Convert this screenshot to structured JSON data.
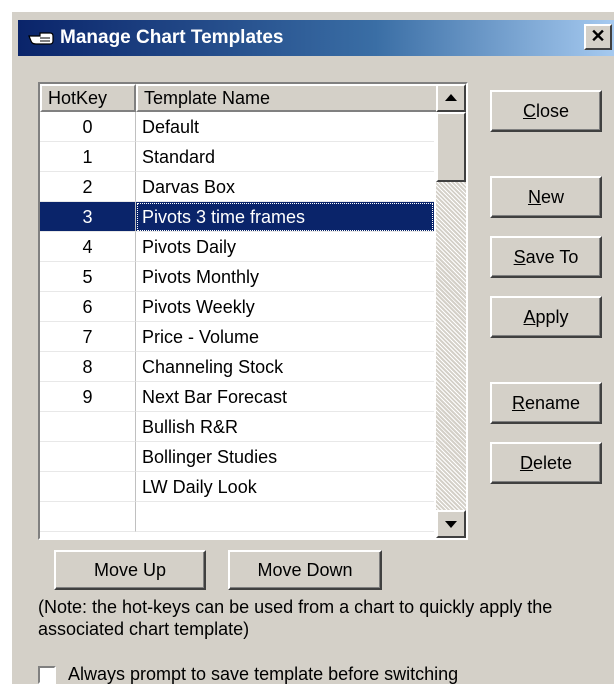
{
  "window": {
    "title": "Manage Chart Templates",
    "close_glyph": "✕"
  },
  "list": {
    "columns": [
      "HotKey",
      "Template Name"
    ],
    "selected_index": 3,
    "rows": [
      {
        "hotkey": "0",
        "name": "Default"
      },
      {
        "hotkey": "1",
        "name": "Standard"
      },
      {
        "hotkey": "2",
        "name": "Darvas Box"
      },
      {
        "hotkey": "3",
        "name": "Pivots 3 time frames"
      },
      {
        "hotkey": "4",
        "name": "Pivots Daily"
      },
      {
        "hotkey": "5",
        "name": "Pivots Monthly"
      },
      {
        "hotkey": "6",
        "name": "Pivots Weekly"
      },
      {
        "hotkey": "7",
        "name": "Price - Volume"
      },
      {
        "hotkey": "8",
        "name": "Channeling Stock"
      },
      {
        "hotkey": "9",
        "name": "Next Bar Forecast"
      },
      {
        "hotkey": "",
        "name": "Bullish R&R"
      },
      {
        "hotkey": "",
        "name": "Bollinger Studies"
      },
      {
        "hotkey": "",
        "name": "LW Daily Look"
      },
      {
        "hotkey": "",
        "name": ""
      }
    ]
  },
  "buttons": {
    "close": {
      "mnemonic": "C",
      "rest": "lose"
    },
    "new": {
      "mnemonic": "N",
      "rest": "ew"
    },
    "save_to": {
      "mnemonic": "S",
      "rest": "ave To"
    },
    "apply": {
      "mnemonic": "A",
      "rest": "pply"
    },
    "rename": {
      "mnemonic": "R",
      "rest": "ename"
    },
    "delete": {
      "mnemonic": "D",
      "rest": "elete"
    },
    "move_up": "Move Up",
    "move_down": "Move Down"
  },
  "note": "(Note: the hot-keys can be used from a chart to quickly apply the associated chart template)",
  "checkbox": {
    "label": "Always prompt to save template before switching",
    "checked": false
  },
  "colors": {
    "title_gradient_start": "#0a246a",
    "selection": "#0a246a",
    "face": "#d4d0c8"
  },
  "icons": {
    "title": "pointing-hand-icon",
    "scroll_up": "arrow-up-icon",
    "scroll_down": "arrow-down-icon"
  }
}
